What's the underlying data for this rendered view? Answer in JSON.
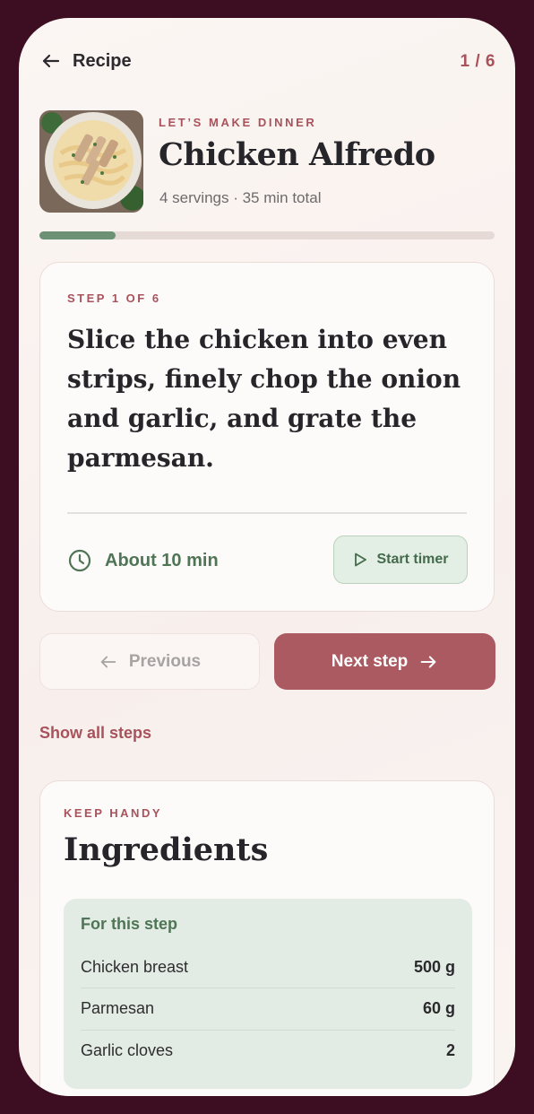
{
  "header": {
    "back_label": "Recipe",
    "step_counter": "1 / 6"
  },
  "recipe": {
    "kicker": "LET’S MAKE DINNER",
    "title": "Chicken Alfredo",
    "meta": "4 servings · 35 min total",
    "image_alt": "Chicken Alfredo pasta in a bowl"
  },
  "progress": {
    "value": 0.1667
  },
  "step": {
    "label": "STEP 1 OF 6",
    "text": "Slice the chicken into even strips, finely chop the onion and garlic, and grate the parmesan.",
    "duration": "About 10 min",
    "timer_button": "Start timer"
  },
  "navigation": {
    "previous": "Previous",
    "next": "Next step",
    "show_all": "Show all steps"
  },
  "ingredients": {
    "kicker": "KEEP HANDY",
    "title": "Ingredients",
    "section_title": "For this step",
    "items": [
      {
        "name": "Chicken breast",
        "qty": "500 g"
      },
      {
        "name": "Parmesan",
        "qty": "60 g"
      },
      {
        "name": "Garlic cloves",
        "qty": "2"
      }
    ]
  },
  "colors": {
    "accent": "#a8525b",
    "accent_button": "#ab5a61",
    "green": "#4f7556",
    "progress_fill": "#6d9174",
    "frame": "#3d0e22"
  },
  "icons": {
    "back": "arrow-left-icon",
    "clock": "clock-icon",
    "play": "play-icon",
    "prev": "arrow-left-icon",
    "next": "arrow-right-icon"
  }
}
